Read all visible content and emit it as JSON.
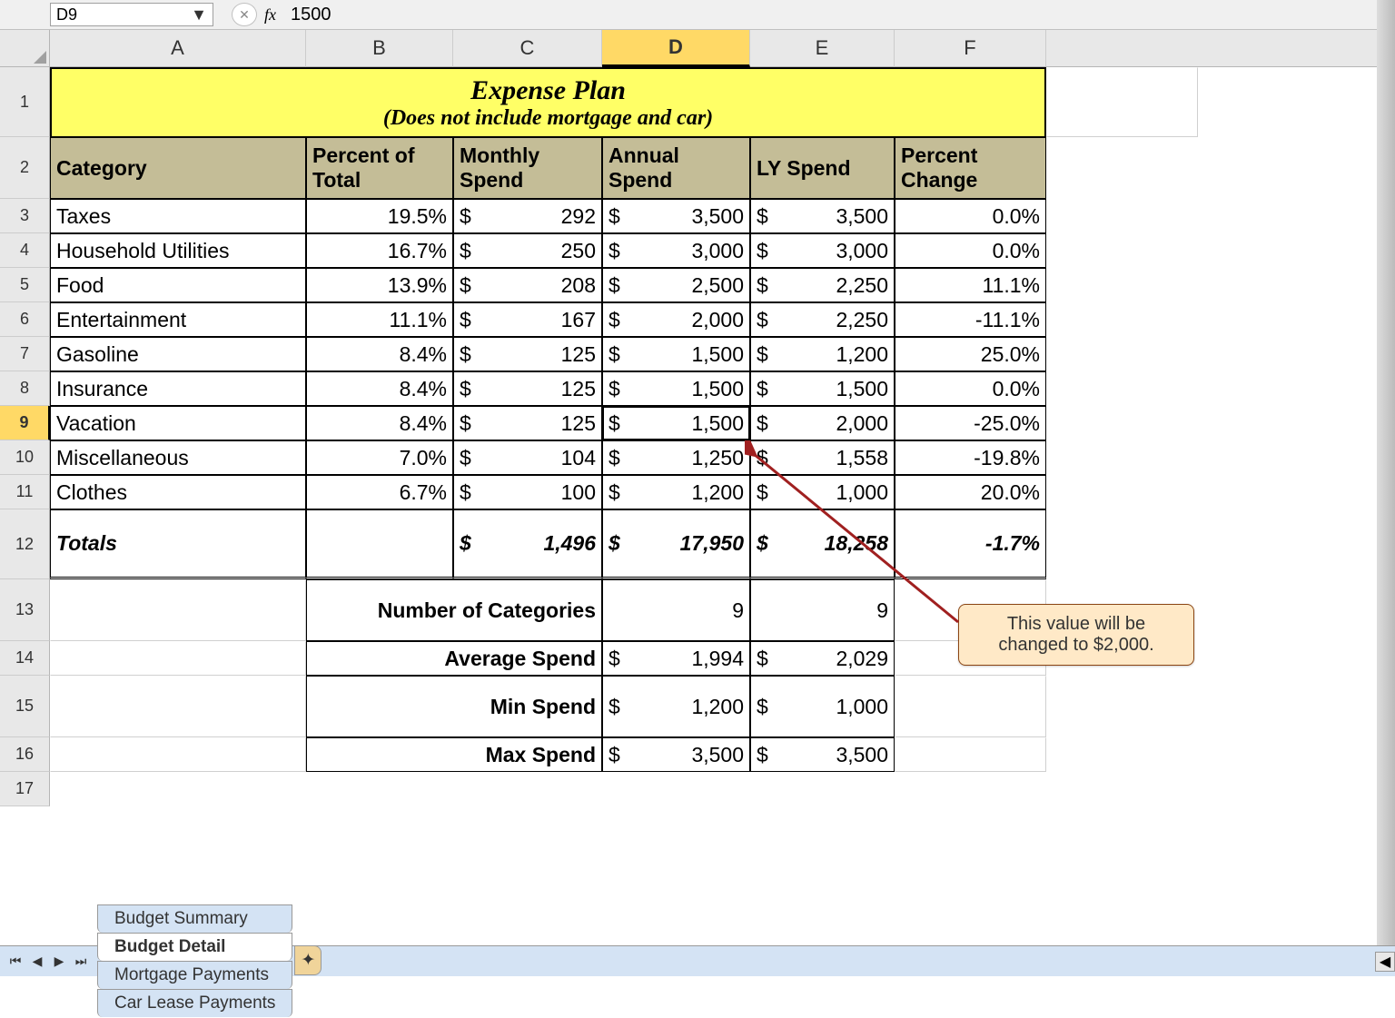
{
  "formulaBar": {
    "cellRef": "D9",
    "fxLabel": "fx",
    "formula": "1500"
  },
  "columns": [
    "A",
    "B",
    "C",
    "D",
    "E",
    "F"
  ],
  "activeCol": "D",
  "activeRow": "9",
  "title": {
    "main": "Expense Plan",
    "sub": "(Does not include mortgage and car)"
  },
  "headers": {
    "cat": "Category",
    "pct": "Percent of Total",
    "mon": "Monthly Spend",
    "ann": "Annual Spend",
    "ly": "LY Spend",
    "chg": "Percent Change"
  },
  "rows": [
    {
      "n": "3",
      "cat": "Taxes",
      "pct": "19.5%",
      "mon": "292",
      "ann": "3,500",
      "ly": "3,500",
      "chg": "0.0%"
    },
    {
      "n": "4",
      "cat": "Household Utilities",
      "pct": "16.7%",
      "mon": "250",
      "ann": "3,000",
      "ly": "3,000",
      "chg": "0.0%"
    },
    {
      "n": "5",
      "cat": "Food",
      "pct": "13.9%",
      "mon": "208",
      "ann": "2,500",
      "ly": "2,250",
      "chg": "11.1%"
    },
    {
      "n": "6",
      "cat": "Entertainment",
      "pct": "11.1%",
      "mon": "167",
      "ann": "2,000",
      "ly": "2,250",
      "chg": "-11.1%"
    },
    {
      "n": "7",
      "cat": "Gasoline",
      "pct": "8.4%",
      "mon": "125",
      "ann": "1,500",
      "ly": "1,200",
      "chg": "25.0%"
    },
    {
      "n": "8",
      "cat": "Insurance",
      "pct": "8.4%",
      "mon": "125",
      "ann": "1,500",
      "ly": "1,500",
      "chg": "0.0%"
    },
    {
      "n": "9",
      "cat": "Vacation",
      "pct": "8.4%",
      "mon": "125",
      "ann": "1,500",
      "ly": "2,000",
      "chg": "-25.0%"
    },
    {
      "n": "10",
      "cat": "Miscellaneous",
      "pct": "7.0%",
      "mon": "104",
      "ann": "1,250",
      "ly": "1,558",
      "chg": "-19.8%"
    },
    {
      "n": "11",
      "cat": "Clothes",
      "pct": "6.7%",
      "mon": "100",
      "ann": "1,200",
      "ly": "1,000",
      "chg": "20.0%"
    }
  ],
  "totals": {
    "label": "Totals",
    "mon": "1,496",
    "ann": "17,950",
    "ly": "18,258",
    "chg": "-1.7%"
  },
  "stats": [
    {
      "n": "13",
      "label": "Number of Categories",
      "d": "9",
      "e": "9",
      "money": false,
      "tall": true
    },
    {
      "n": "14",
      "label": "Average Spend",
      "d": "1,994",
      "e": "2,029",
      "money": true,
      "tall": false
    },
    {
      "n": "15",
      "label": "Min Spend",
      "d": "1,200",
      "e": "1,000",
      "money": true,
      "tall": true
    },
    {
      "n": "16",
      "label": "Max Spend",
      "d": "3,500",
      "e": "3,500",
      "money": true,
      "tall": false
    }
  ],
  "callout": "This value will be changed to $2,000.",
  "tabs": {
    "items": [
      "Budget Summary",
      "Budget Detail",
      "Mortgage Payments",
      "Car Lease Payments"
    ],
    "active": "Budget Detail"
  },
  "dollar": "$"
}
